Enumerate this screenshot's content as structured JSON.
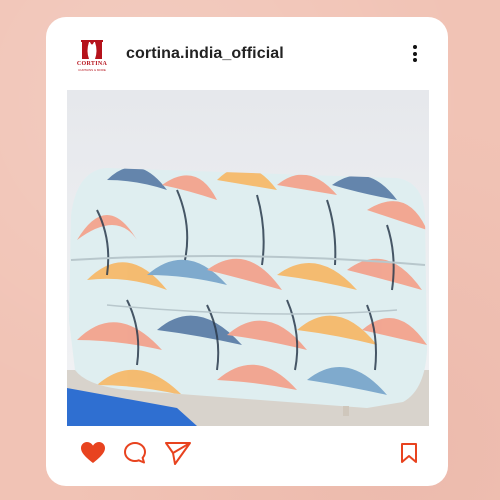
{
  "post": {
    "account": {
      "username": "cortina.india_official",
      "avatar_brand": "CORTINA",
      "avatar_tagline": "CURTAINS & MORE"
    },
    "image": {
      "subject": "sofa-with-patterned-stretch-cover"
    },
    "actions": {
      "like_icon": "heart-icon",
      "like_state": "liked",
      "comment_icon": "comment-icon",
      "share_icon": "send-icon",
      "save_icon": "bookmark-icon"
    }
  },
  "colors": {
    "background": "#f1c3b5",
    "card": "#ffffff",
    "like": "#e8431f",
    "icon_accent": "#e8431f",
    "brand_red": "#b5121b"
  }
}
